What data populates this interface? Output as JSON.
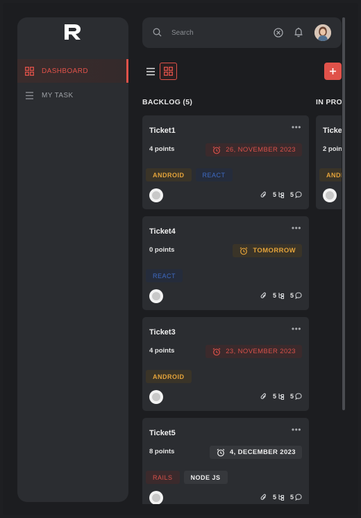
{
  "sidebar": {
    "items": [
      {
        "label": "DASHBOARD",
        "icon": "grid-icon",
        "active": true
      },
      {
        "label": "MY TASK",
        "icon": "menu-icon",
        "active": false
      }
    ]
  },
  "topbar": {
    "search_placeholder": "Search"
  },
  "board": {
    "columns": [
      {
        "title": "BACKLOG (5)",
        "cards": [
          {
            "title": "Ticket1",
            "points": "4 points",
            "due": "26, NOVEMBER 2023",
            "tags": [
              "ANDROID",
              "REACT"
            ],
            "attachments": "",
            "subtasks": "5",
            "comments": "5"
          },
          {
            "title": "Ticket4",
            "points": "0 points",
            "due": "TOMORROW",
            "tags": [
              "REACT"
            ],
            "attachments": "",
            "subtasks": "5",
            "comments": "5"
          },
          {
            "title": "Ticket3",
            "points": "4 points",
            "due": "23, NOVEMBER 2023",
            "tags": [
              "ANDROID"
            ],
            "attachments": "",
            "subtasks": "5",
            "comments": "5"
          },
          {
            "title": "Ticket5",
            "points": "8 points",
            "due": "4, DECEMBER 2023",
            "tags": [
              "RAILS",
              "NODE JS"
            ],
            "attachments": "",
            "subtasks": "5",
            "comments": "5"
          }
        ]
      },
      {
        "title": "IN PRO",
        "cards": [
          {
            "title": "Ticke",
            "points": "2 poin",
            "tags": [
              "ANDI"
            ]
          }
        ]
      }
    ]
  },
  "colors": {
    "accent": "#e0524a",
    "warning": "#e4a33a",
    "info": "#3e6bc5",
    "surface": "#2b2d31",
    "background": "#1c1d20"
  }
}
